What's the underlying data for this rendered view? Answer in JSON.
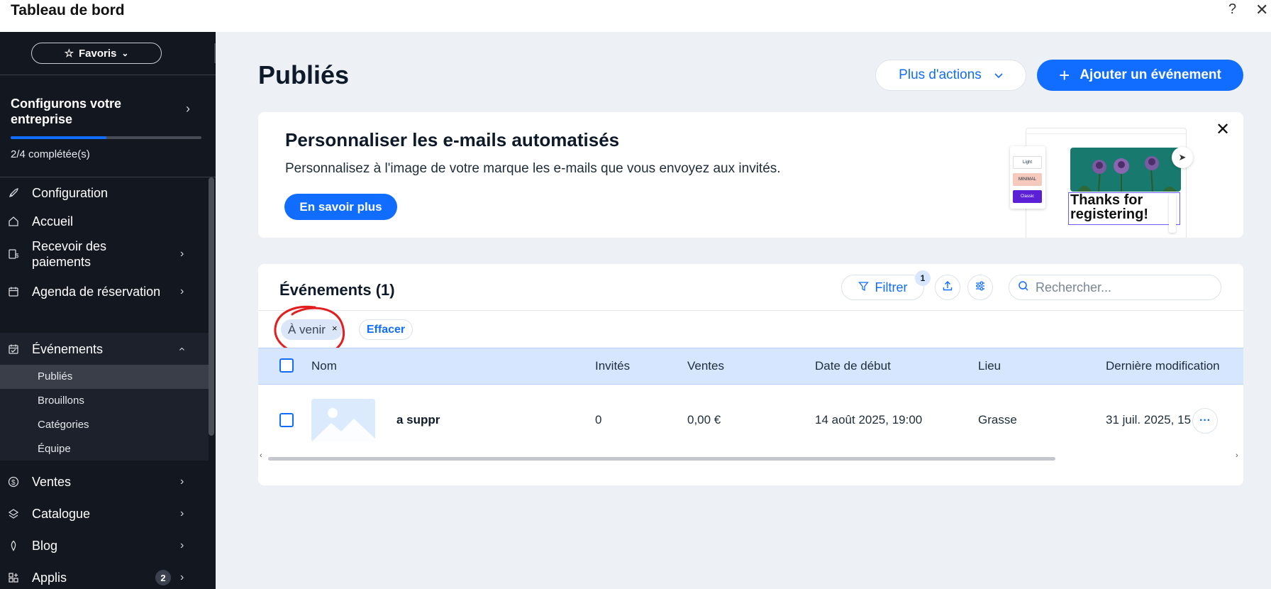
{
  "window": {
    "title": "Tableau de bord",
    "help_icon": "?",
    "close_icon": "✕"
  },
  "sidebar": {
    "favorites_label": "Favoris",
    "setup": {
      "title": "Configurons votre entreprise",
      "progress_text": "2/4 complétée(s)",
      "progress_fraction": 0.5
    },
    "items": [
      {
        "label": "Configuration",
        "icon": "rocket-icon"
      },
      {
        "label": "Accueil",
        "icon": "home-icon"
      },
      {
        "label": "Recevoir des paiements",
        "icon": "payment-icon"
      },
      {
        "label": "Agenda de réservation",
        "icon": "calendar-icon"
      },
      {
        "label": "Événements",
        "icon": "events-icon"
      },
      {
        "label": "Ventes",
        "icon": "dollar-icon"
      },
      {
        "label": "Catalogue",
        "icon": "catalog-icon"
      },
      {
        "label": "Blog",
        "icon": "pen-icon"
      },
      {
        "label": "Applis",
        "icon": "apps-icon",
        "badge": "2"
      }
    ],
    "events_sub": [
      "Publiés",
      "Brouillons",
      "Catégories",
      "Équipe"
    ]
  },
  "header": {
    "title": "Publiés",
    "more_actions": "Plus d'actions",
    "add_event": "Ajouter un événement"
  },
  "promo": {
    "title": "Personnaliser les e-mails automatisés",
    "subtitle": "Personnalisez à l'image de votre marque les e-mails que vous envoyez aux invités.",
    "cta": "En savoir plus",
    "art_text": "Thanks for registering!",
    "art_themes": [
      "Light",
      "MINIMAL",
      "Classic"
    ]
  },
  "events": {
    "title": "Événements (1)",
    "filter_label": "Filtrer",
    "filter_count": "1",
    "search_placeholder": "Rechercher...",
    "chip_label": "À venir",
    "chip_remove": "×",
    "clear_label": "Effacer",
    "columns": [
      "Nom",
      "Invités",
      "Ventes",
      "Date de début",
      "Lieu",
      "Dernière modification"
    ],
    "rows": [
      {
        "name": "a suppr",
        "guests": "0",
        "sales": "0,00 €",
        "start": "14 août 2025, 19:00",
        "place": "Grasse",
        "modified": "31 juil. 2025, 15"
      }
    ]
  },
  "colors": {
    "accent": "#116dff",
    "sidebar_bg": "#131720",
    "main_bg": "#edf0f4",
    "annotation": "#e0201e"
  }
}
